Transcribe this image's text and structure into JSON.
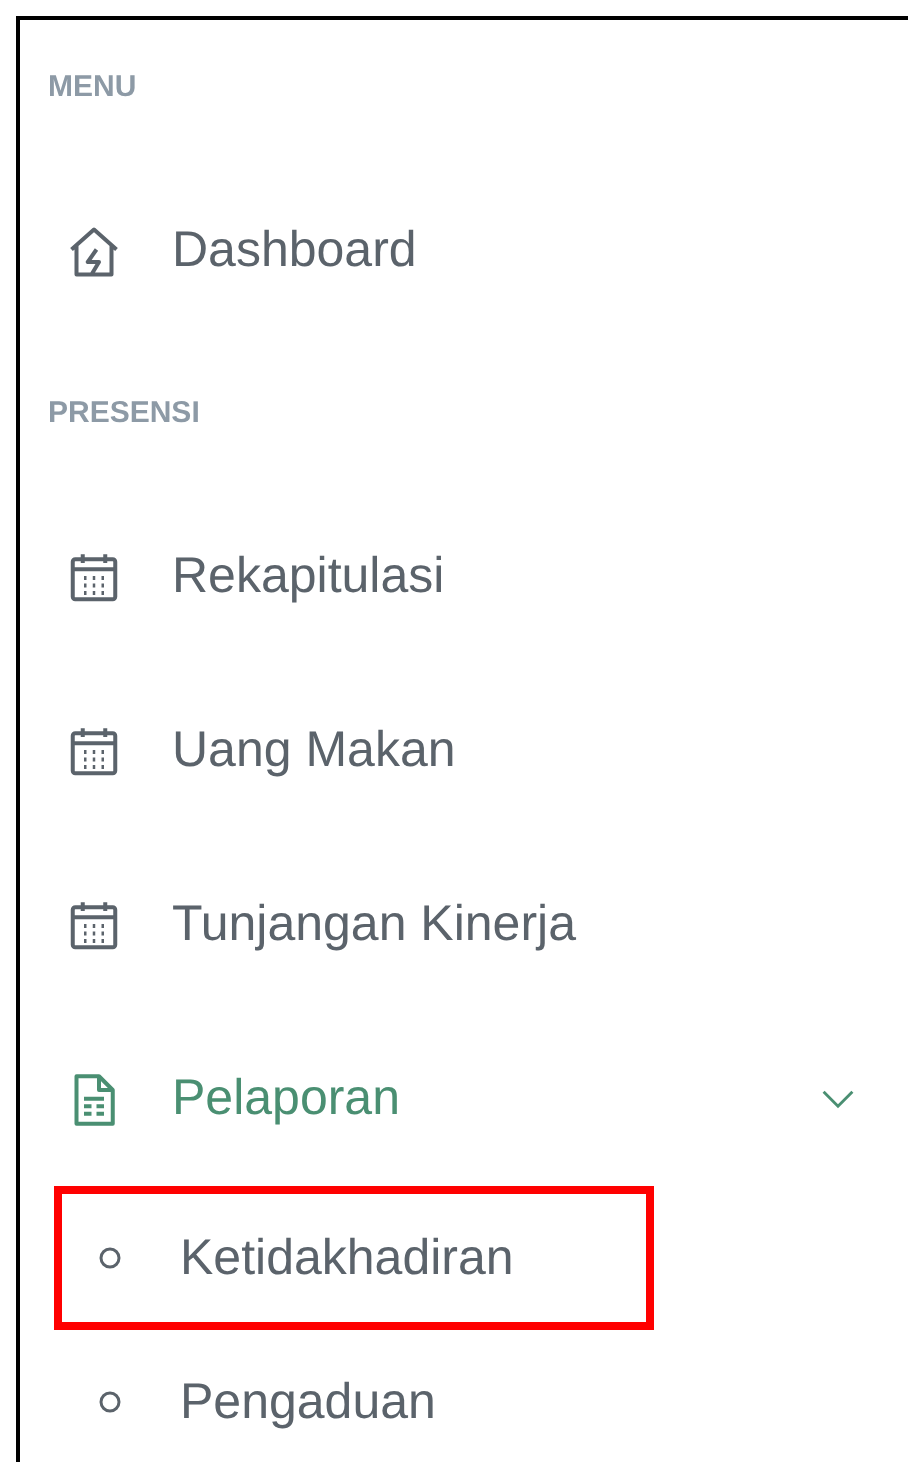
{
  "sections": [
    {
      "heading": "MENU",
      "items": [
        {
          "label": "Dashboard",
          "kind": "home",
          "active": false
        }
      ]
    },
    {
      "heading": "PRESENSI",
      "items": [
        {
          "label": "Rekapitulasi",
          "kind": "calendar",
          "active": false
        },
        {
          "label": "Uang Makan",
          "kind": "calendar",
          "active": false
        },
        {
          "label": "Tunjangan Kinerja",
          "kind": "calendar",
          "active": false
        },
        {
          "label": "Pelaporan",
          "kind": "group",
          "active": true,
          "expanded": true,
          "children": [
            {
              "label": "Ketidakhadiran",
              "highlighted": true
            },
            {
              "label": "Pengaduan",
              "highlighted": false
            }
          ]
        }
      ]
    }
  ]
}
